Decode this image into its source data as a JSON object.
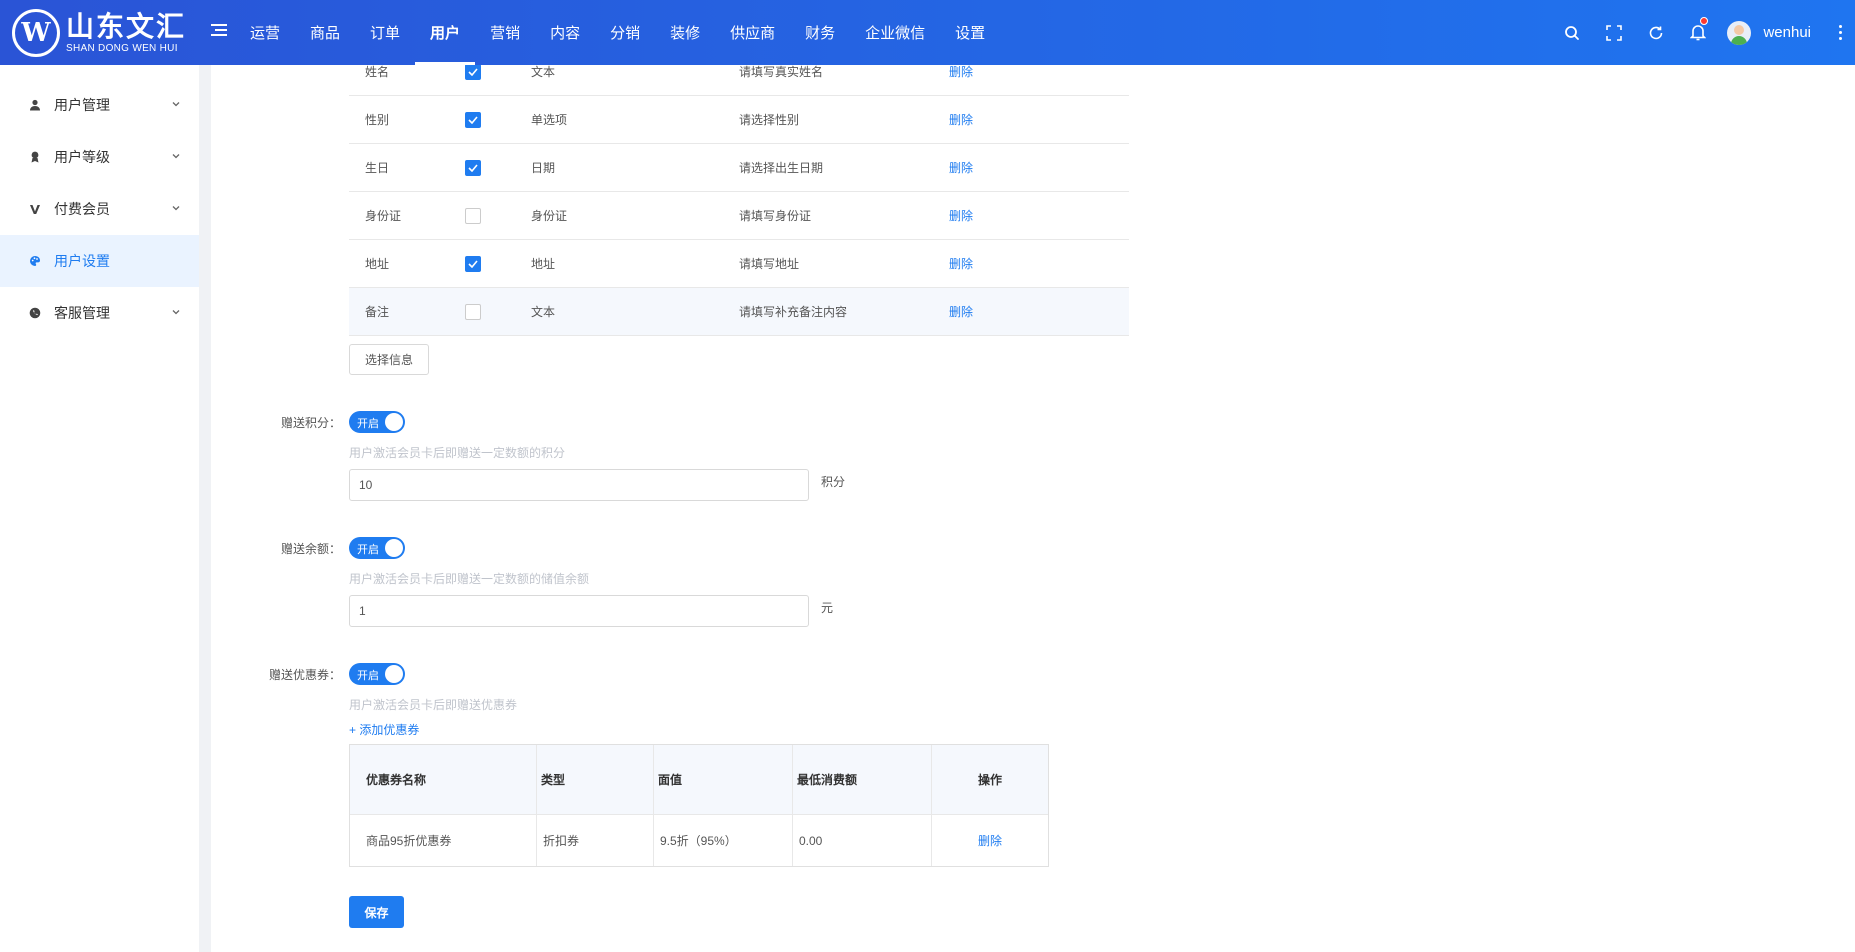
{
  "header": {
    "logo_cn": "山东文汇",
    "logo_en": "SHAN DONG WEN HUI",
    "logo_mark": "W",
    "nav": [
      {
        "label": "运营"
      },
      {
        "label": "商品"
      },
      {
        "label": "订单"
      },
      {
        "label": "用户",
        "active": true
      },
      {
        "label": "营销"
      },
      {
        "label": "内容"
      },
      {
        "label": "分销"
      },
      {
        "label": "装修"
      },
      {
        "label": "供应商"
      },
      {
        "label": "财务"
      },
      {
        "label": "企业微信"
      },
      {
        "label": "设置"
      }
    ],
    "username": "wenhui",
    "icons": [
      "search-icon",
      "fullscreen-icon",
      "refresh-icon",
      "bell-icon",
      "more-icon"
    ]
  },
  "sidebar": {
    "items": [
      {
        "label": "用户管理",
        "icon": "user-icon"
      },
      {
        "label": "用户等级",
        "icon": "level-icon"
      },
      {
        "label": "付费会员",
        "icon": "vip-icon"
      },
      {
        "label": "用户设置",
        "icon": "palette-icon",
        "active": true
      },
      {
        "label": "客服管理",
        "icon": "service-icon"
      }
    ]
  },
  "info_rows": [
    {
      "name": "姓名",
      "checked": true,
      "type": "文本",
      "placeholder": "请填写真实姓名",
      "action": "删除"
    },
    {
      "name": "性别",
      "checked": true,
      "type": "单选项",
      "placeholder": "请选择性别",
      "action": "删除"
    },
    {
      "name": "生日",
      "checked": true,
      "type": "日期",
      "placeholder": "请选择出生日期",
      "action": "删除"
    },
    {
      "name": "身份证",
      "checked": false,
      "type": "身份证",
      "placeholder": "请填写身份证",
      "action": "删除"
    },
    {
      "name": "地址",
      "checked": true,
      "type": "地址",
      "placeholder": "请填写地址",
      "action": "删除"
    },
    {
      "name": "备注",
      "checked": false,
      "type": "文本",
      "placeholder": "请填写补充备注内容",
      "action": "删除"
    }
  ],
  "select_info_label": "选择信息",
  "points": {
    "label": "赠送积分：",
    "switch_text": "开启",
    "help": "用户激活会员卡后即赠送一定数额的积分",
    "value": "10",
    "unit": "积分"
  },
  "balance": {
    "label": "赠送余额：",
    "switch_text": "开启",
    "help": "用户激活会员卡后即赠送一定数额的储值余额",
    "value": "1",
    "unit": "元"
  },
  "coupon": {
    "label": "赠送优惠券：",
    "switch_text": "开启",
    "help": "用户激活会员卡后即赠送优惠券",
    "add_link": "+ 添加优惠券",
    "columns": [
      "优惠券名称",
      "类型",
      "面值",
      "最低消费额",
      "操作"
    ],
    "rows": [
      {
        "name": "商品95折优惠券",
        "type": "折扣券",
        "value": "9.5折（95%）",
        "min": "0.00",
        "action": "删除"
      }
    ]
  },
  "save_label": "保存"
}
